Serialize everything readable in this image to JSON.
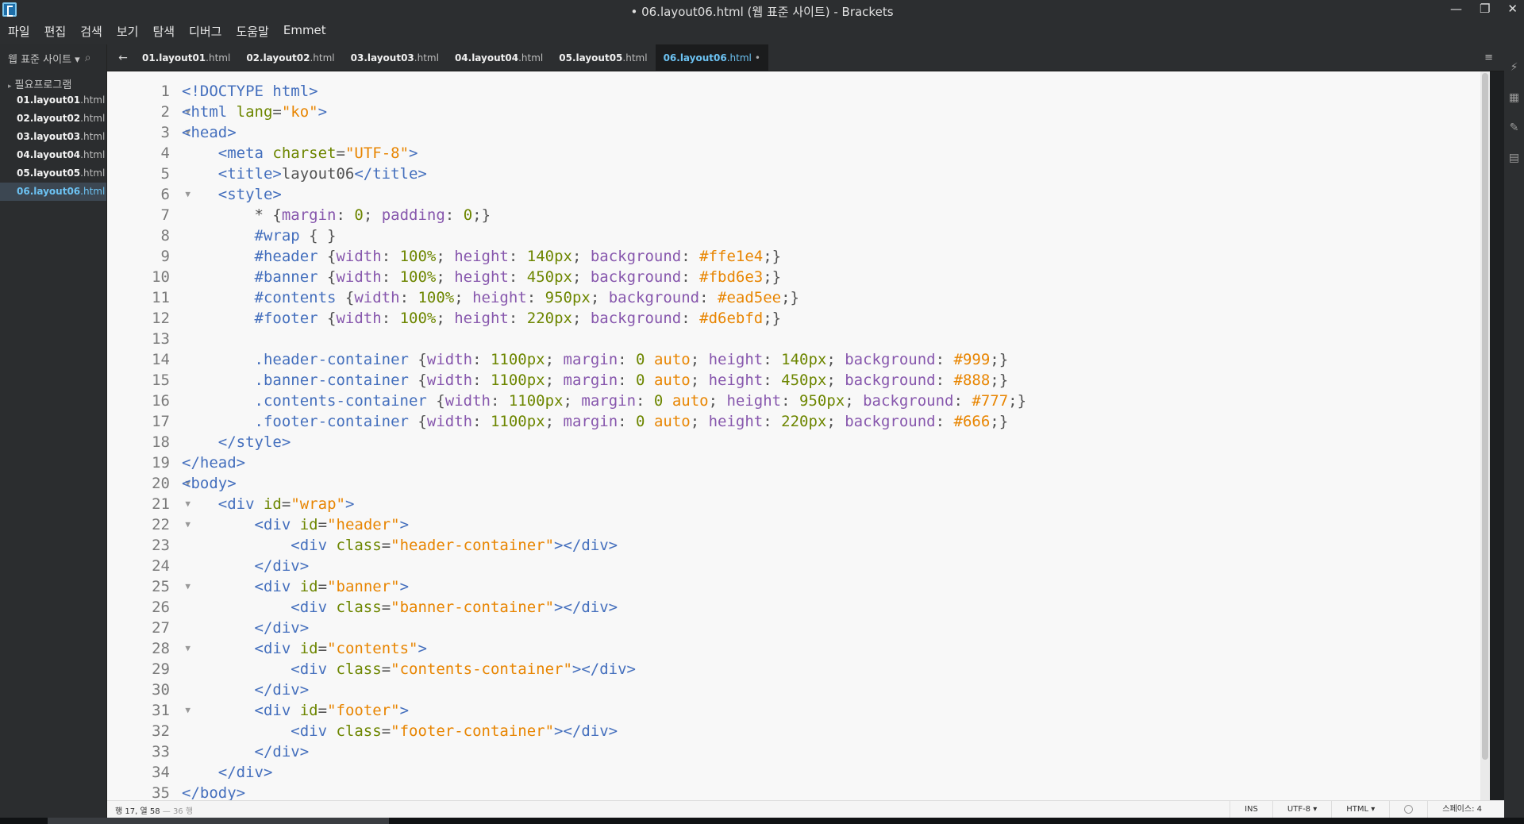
{
  "window": {
    "title": "• 06.layout06.html (웹 표준 사이트) - Brackets",
    "minimize": "—",
    "restore": "❐",
    "close": "✕"
  },
  "menu": [
    "파일",
    "편집",
    "검색",
    "보기",
    "탐색",
    "디버그",
    "도움말",
    "Emmet"
  ],
  "sidebar": {
    "project": "웹 표준 사이트 ▾",
    "folder": "필요프로그램",
    "files": [
      {
        "base": "01.layout01",
        "ext": ".html"
      },
      {
        "base": "02.layout02",
        "ext": ".html"
      },
      {
        "base": "03.layout03",
        "ext": ".html"
      },
      {
        "base": "04.layout04",
        "ext": ".html"
      },
      {
        "base": "05.layout05",
        "ext": ".html"
      },
      {
        "base": "06.layout06",
        "ext": ".html"
      }
    ],
    "active_index": 5
  },
  "tabs": [
    {
      "base": "01.layout01",
      "ext": ".html"
    },
    {
      "base": "02.layout02",
      "ext": ".html"
    },
    {
      "base": "03.layout03",
      "ext": ".html"
    },
    {
      "base": "04.layout04",
      "ext": ".html"
    },
    {
      "base": "05.layout05",
      "ext": ".html"
    },
    {
      "base": "06.layout06",
      "ext": ".html",
      "dirty": "•"
    }
  ],
  "code": [
    [
      [
        "tag",
        "<!DOCTYPE html>"
      ]
    ],
    [
      [
        "tag",
        "<html "
      ],
      [
        "attr",
        "lang"
      ],
      [
        "txt",
        "="
      ],
      [
        "str",
        "\"ko\""
      ],
      [
        "tag",
        ">"
      ]
    ],
    [
      [
        "tag",
        "<head>"
      ]
    ],
    [
      [
        "txt",
        "    "
      ],
      [
        "tag",
        "<meta "
      ],
      [
        "attr",
        "charset"
      ],
      [
        "txt",
        "="
      ],
      [
        "str",
        "\"UTF-8\""
      ],
      [
        "tag",
        ">"
      ]
    ],
    [
      [
        "txt",
        "    "
      ],
      [
        "tag",
        "<title>"
      ],
      [
        "txt",
        "layout06"
      ],
      [
        "tag",
        "</title>"
      ]
    ],
    [
      [
        "txt",
        "    "
      ],
      [
        "tag",
        "<style>"
      ]
    ],
    [
      [
        "txt",
        "        * {"
      ],
      [
        "prop",
        "margin"
      ],
      [
        "txt",
        ": "
      ],
      [
        "num",
        "0"
      ],
      [
        "txt",
        "; "
      ],
      [
        "prop",
        "padding"
      ],
      [
        "txt",
        ": "
      ],
      [
        "num",
        "0"
      ],
      [
        "txt",
        ";}"
      ]
    ],
    [
      [
        "txt",
        "        "
      ],
      [
        "sel",
        "#wrap"
      ],
      [
        "txt",
        " { }"
      ]
    ],
    [
      [
        "txt",
        "        "
      ],
      [
        "sel",
        "#header"
      ],
      [
        "txt",
        " {"
      ],
      [
        "prop",
        "width"
      ],
      [
        "txt",
        ": "
      ],
      [
        "num",
        "100%"
      ],
      [
        "txt",
        "; "
      ],
      [
        "prop",
        "height"
      ],
      [
        "txt",
        ": "
      ],
      [
        "num",
        "140px"
      ],
      [
        "txt",
        "; "
      ],
      [
        "prop",
        "background"
      ],
      [
        "txt",
        ": "
      ],
      [
        "hex",
        "#ffe1e4"
      ],
      [
        "txt",
        ";}"
      ]
    ],
    [
      [
        "txt",
        "        "
      ],
      [
        "sel",
        "#banner"
      ],
      [
        "txt",
        " {"
      ],
      [
        "prop",
        "width"
      ],
      [
        "txt",
        ": "
      ],
      [
        "num",
        "100%"
      ],
      [
        "txt",
        "; "
      ],
      [
        "prop",
        "height"
      ],
      [
        "txt",
        ": "
      ],
      [
        "num",
        "450px"
      ],
      [
        "txt",
        "; "
      ],
      [
        "prop",
        "background"
      ],
      [
        "txt",
        ": "
      ],
      [
        "hex",
        "#fbd6e3"
      ],
      [
        "txt",
        ";}"
      ]
    ],
    [
      [
        "txt",
        "        "
      ],
      [
        "sel",
        "#contents"
      ],
      [
        "txt",
        " {"
      ],
      [
        "prop",
        "width"
      ],
      [
        "txt",
        ": "
      ],
      [
        "num",
        "100%"
      ],
      [
        "txt",
        "; "
      ],
      [
        "prop",
        "height"
      ],
      [
        "txt",
        ": "
      ],
      [
        "num",
        "950px"
      ],
      [
        "txt",
        "; "
      ],
      [
        "prop",
        "background"
      ],
      [
        "txt",
        ": "
      ],
      [
        "hex",
        "#ead5ee"
      ],
      [
        "txt",
        ";}"
      ]
    ],
    [
      [
        "txt",
        "        "
      ],
      [
        "sel",
        "#footer"
      ],
      [
        "txt",
        " {"
      ],
      [
        "prop",
        "width"
      ],
      [
        "txt",
        ": "
      ],
      [
        "num",
        "100%"
      ],
      [
        "txt",
        "; "
      ],
      [
        "prop",
        "height"
      ],
      [
        "txt",
        ": "
      ],
      [
        "num",
        "220px"
      ],
      [
        "txt",
        "; "
      ],
      [
        "prop",
        "background"
      ],
      [
        "txt",
        ": "
      ],
      [
        "hex",
        "#d6ebfd"
      ],
      [
        "txt",
        ";}"
      ]
    ],
    [
      [
        "txt",
        ""
      ]
    ],
    [
      [
        "txt",
        "        "
      ],
      [
        "sel",
        ".header-container"
      ],
      [
        "txt",
        " {"
      ],
      [
        "prop",
        "width"
      ],
      [
        "txt",
        ": "
      ],
      [
        "num",
        "1100px"
      ],
      [
        "txt",
        "; "
      ],
      [
        "prop",
        "margin"
      ],
      [
        "txt",
        ": "
      ],
      [
        "num",
        "0"
      ],
      [
        "txt",
        " "
      ],
      [
        "hex",
        "auto"
      ],
      [
        "txt",
        "; "
      ],
      [
        "prop",
        "height"
      ],
      [
        "txt",
        ": "
      ],
      [
        "num",
        "140px"
      ],
      [
        "txt",
        "; "
      ],
      [
        "prop",
        "background"
      ],
      [
        "txt",
        ": "
      ],
      [
        "hex",
        "#999"
      ],
      [
        "txt",
        ";}"
      ]
    ],
    [
      [
        "txt",
        "        "
      ],
      [
        "sel",
        ".banner-container"
      ],
      [
        "txt",
        " {"
      ],
      [
        "prop",
        "width"
      ],
      [
        "txt",
        ": "
      ],
      [
        "num",
        "1100px"
      ],
      [
        "txt",
        "; "
      ],
      [
        "prop",
        "margin"
      ],
      [
        "txt",
        ": "
      ],
      [
        "num",
        "0"
      ],
      [
        "txt",
        " "
      ],
      [
        "hex",
        "auto"
      ],
      [
        "txt",
        "; "
      ],
      [
        "prop",
        "height"
      ],
      [
        "txt",
        ": "
      ],
      [
        "num",
        "450px"
      ],
      [
        "txt",
        "; "
      ],
      [
        "prop",
        "background"
      ],
      [
        "txt",
        ": "
      ],
      [
        "hex",
        "#888"
      ],
      [
        "txt",
        ";}"
      ]
    ],
    [
      [
        "txt",
        "        "
      ],
      [
        "sel",
        ".contents-container"
      ],
      [
        "txt",
        " {"
      ],
      [
        "prop",
        "width"
      ],
      [
        "txt",
        ": "
      ],
      [
        "num",
        "1100px"
      ],
      [
        "txt",
        "; "
      ],
      [
        "prop",
        "margin"
      ],
      [
        "txt",
        ": "
      ],
      [
        "num",
        "0"
      ],
      [
        "txt",
        " "
      ],
      [
        "hex",
        "auto"
      ],
      [
        "txt",
        "; "
      ],
      [
        "prop",
        "height"
      ],
      [
        "txt",
        ": "
      ],
      [
        "num",
        "950px"
      ],
      [
        "txt",
        "; "
      ],
      [
        "prop",
        "background"
      ],
      [
        "txt",
        ": "
      ],
      [
        "hex",
        "#777"
      ],
      [
        "txt",
        ";}"
      ]
    ],
    [
      [
        "txt",
        "        "
      ],
      [
        "sel",
        ".footer-container"
      ],
      [
        "txt",
        " {"
      ],
      [
        "prop",
        "width"
      ],
      [
        "txt",
        ": "
      ],
      [
        "num",
        "1100px"
      ],
      [
        "txt",
        "; "
      ],
      [
        "prop",
        "margin"
      ],
      [
        "txt",
        ": "
      ],
      [
        "num",
        "0"
      ],
      [
        "txt",
        " "
      ],
      [
        "hex",
        "auto"
      ],
      [
        "txt",
        "; "
      ],
      [
        "prop",
        "height"
      ],
      [
        "txt",
        ": "
      ],
      [
        "num",
        "220px"
      ],
      [
        "txt",
        "; "
      ],
      [
        "prop",
        "background"
      ],
      [
        "txt",
        ": "
      ],
      [
        "hex",
        "#666"
      ],
      [
        "txt",
        ";}"
      ]
    ],
    [
      [
        "txt",
        "    "
      ],
      [
        "tag",
        "</style>"
      ]
    ],
    [
      [
        "tag",
        "</head>"
      ]
    ],
    [
      [
        "tag",
        "<body>"
      ]
    ],
    [
      [
        "txt",
        "    "
      ],
      [
        "tag",
        "<div "
      ],
      [
        "attr",
        "id"
      ],
      [
        "txt",
        "="
      ],
      [
        "str",
        "\"wrap\""
      ],
      [
        "tag",
        ">"
      ]
    ],
    [
      [
        "txt",
        "        "
      ],
      [
        "tag",
        "<div "
      ],
      [
        "attr",
        "id"
      ],
      [
        "txt",
        "="
      ],
      [
        "str",
        "\"header\""
      ],
      [
        "tag",
        ">"
      ]
    ],
    [
      [
        "txt",
        "            "
      ],
      [
        "tag",
        "<div "
      ],
      [
        "attr",
        "class"
      ],
      [
        "txt",
        "="
      ],
      [
        "str",
        "\"header-container\""
      ],
      [
        "tag",
        "></div>"
      ]
    ],
    [
      [
        "txt",
        "        "
      ],
      [
        "tag",
        "</div>"
      ]
    ],
    [
      [
        "txt",
        "        "
      ],
      [
        "tag",
        "<div "
      ],
      [
        "attr",
        "id"
      ],
      [
        "txt",
        "="
      ],
      [
        "str",
        "\"banner\""
      ],
      [
        "tag",
        ">"
      ]
    ],
    [
      [
        "txt",
        "            "
      ],
      [
        "tag",
        "<div "
      ],
      [
        "attr",
        "class"
      ],
      [
        "txt",
        "="
      ],
      [
        "str",
        "\"banner-container\""
      ],
      [
        "tag",
        "></div>"
      ]
    ],
    [
      [
        "txt",
        "        "
      ],
      [
        "tag",
        "</div>"
      ]
    ],
    [
      [
        "txt",
        "        "
      ],
      [
        "tag",
        "<div "
      ],
      [
        "attr",
        "id"
      ],
      [
        "txt",
        "="
      ],
      [
        "str",
        "\"contents\""
      ],
      [
        "tag",
        ">"
      ]
    ],
    [
      [
        "txt",
        "            "
      ],
      [
        "tag",
        "<div "
      ],
      [
        "attr",
        "class"
      ],
      [
        "txt",
        "="
      ],
      [
        "str",
        "\"contents-container\""
      ],
      [
        "tag",
        "></div>"
      ]
    ],
    [
      [
        "txt",
        "        "
      ],
      [
        "tag",
        "</div>"
      ]
    ],
    [
      [
        "txt",
        "        "
      ],
      [
        "tag",
        "<div "
      ],
      [
        "attr",
        "id"
      ],
      [
        "txt",
        "="
      ],
      [
        "str",
        "\"footer\""
      ],
      [
        "tag",
        ">"
      ]
    ],
    [
      [
        "txt",
        "            "
      ],
      [
        "tag",
        "<div "
      ],
      [
        "attr",
        "class"
      ],
      [
        "txt",
        "="
      ],
      [
        "str",
        "\"footer-container\""
      ],
      [
        "tag",
        "></div>"
      ]
    ],
    [
      [
        "txt",
        "        "
      ],
      [
        "tag",
        "</div>"
      ]
    ],
    [
      [
        "txt",
        "    "
      ],
      [
        "tag",
        "</div>"
      ]
    ],
    [
      [
        "tag",
        "</body>"
      ]
    ]
  ],
  "fold_lines": [
    2,
    3,
    6,
    20,
    21,
    22,
    25,
    28,
    31
  ],
  "status": {
    "position": "행 17, 열 58",
    "lines": "— 36 행",
    "ins": "INS",
    "encoding": "UTF-8 ▾",
    "language": "HTML ▾",
    "spaces": "스페이스: 4"
  },
  "colors": {
    "editor_bg": "#f8f8f8",
    "tag": "#446fbd",
    "attr": "#6d8600",
    "string": "#e88501",
    "property": "#8757ad",
    "active_file": "#6cc2f2"
  }
}
